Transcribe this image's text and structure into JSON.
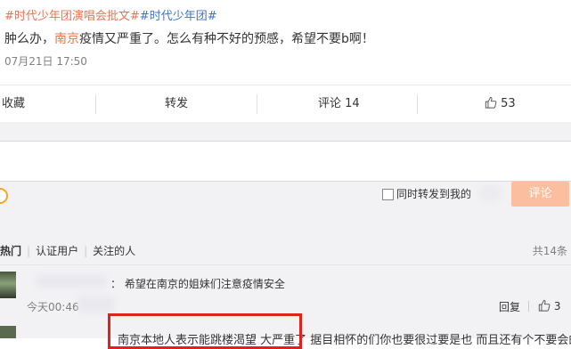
{
  "post": {
    "topic1": "#时代少年团演唱会批文#",
    "topic2": "#时代少年团#",
    "text_before": "肿么办，",
    "text_place": "南京",
    "text_after": "疫情又严重了。怎么有种不好的预感，希望不要b啊！",
    "time": "07月21日 17:50"
  },
  "actions": {
    "favorite": "收藏",
    "repost": "转发",
    "comment": "评论 14",
    "like_count": "53"
  },
  "composer": {
    "repost_option": "同时转发到我的",
    "submit": "评论"
  },
  "filters": {
    "hot": "热门",
    "verified": "认证用户",
    "following": "关注的人",
    "total": "共14条"
  },
  "comments": [
    {
      "text": "：  希望在南京的姐妹们注意疫情安全",
      "time": "今天00:46",
      "reply": "回复",
      "likes": "3"
    },
    {
      "text": "南京本地人表示能跳楼渴望 大严重了 据目相怀的们你也要很过要是也 而且还有个不要会的"
    }
  ],
  "icons": {
    "like": "thumbs-up-icon",
    "emoji": "emoji-icon",
    "checkbox": "checkbox-icon"
  },
  "colors": {
    "accent": "#eb7350",
    "topic_link": "#3c77c9",
    "submit_bg": "#fbbfa0",
    "highlight_border": "#e0221d"
  }
}
